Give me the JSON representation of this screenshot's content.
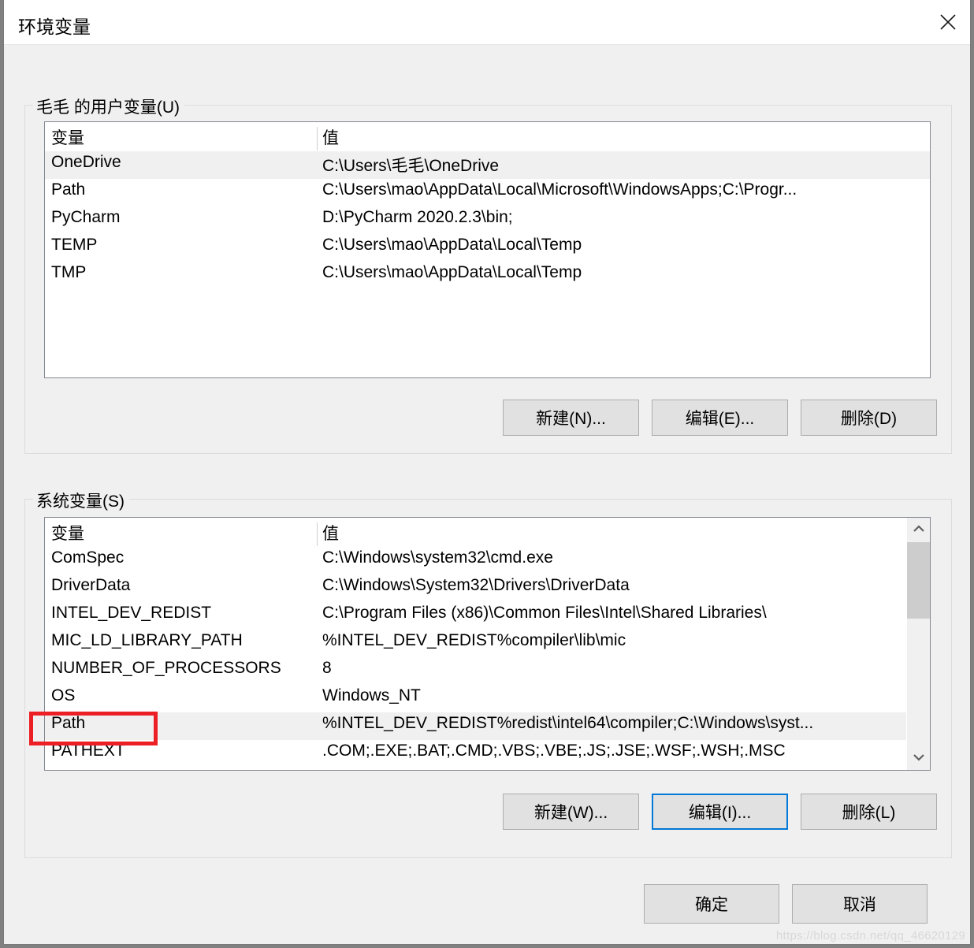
{
  "window": {
    "title": "环境变量",
    "close_icon": "close-icon"
  },
  "user_section": {
    "legend": "毛毛 的用户变量(U)",
    "columns": [
      "变量",
      "值"
    ],
    "rows": [
      {
        "name": "OneDrive",
        "value": "C:\\Users\\毛毛\\OneDrive",
        "selected": true
      },
      {
        "name": "Path",
        "value": "C:\\Users\\mao\\AppData\\Local\\Microsoft\\WindowsApps;C:\\Progr...",
        "selected": false
      },
      {
        "name": "PyCharm",
        "value": "D:\\PyCharm 2020.2.3\\bin;",
        "selected": false
      },
      {
        "name": "TEMP",
        "value": "C:\\Users\\mao\\AppData\\Local\\Temp",
        "selected": false
      },
      {
        "name": "TMP",
        "value": "C:\\Users\\mao\\AppData\\Local\\Temp",
        "selected": false
      }
    ],
    "buttons": {
      "new": "新建(N)...",
      "edit": "编辑(E)...",
      "delete": "删除(D)"
    }
  },
  "system_section": {
    "legend": "系统变量(S)",
    "columns": [
      "变量",
      "值"
    ],
    "rows": [
      {
        "name": "ComSpec",
        "value": "C:\\Windows\\system32\\cmd.exe",
        "selected": false
      },
      {
        "name": "DriverData",
        "value": "C:\\Windows\\System32\\Drivers\\DriverData",
        "selected": false
      },
      {
        "name": "INTEL_DEV_REDIST",
        "value": "C:\\Program Files (x86)\\Common Files\\Intel\\Shared Libraries\\",
        "selected": false
      },
      {
        "name": "MIC_LD_LIBRARY_PATH",
        "value": "%INTEL_DEV_REDIST%compiler\\lib\\mic",
        "selected": false
      },
      {
        "name": "NUMBER_OF_PROCESSORS",
        "value": "8",
        "selected": false
      },
      {
        "name": "OS",
        "value": "Windows_NT",
        "selected": false
      },
      {
        "name": "Path",
        "value": "%INTEL_DEV_REDIST%redist\\intel64\\compiler;C:\\Windows\\syst...",
        "selected": true
      },
      {
        "name": "PATHEXT",
        "value": ".COM;.EXE;.BAT;.CMD;.VBS;.VBE;.JS;.JSE;.WSF;.WSH;.MSC",
        "selected": false
      }
    ],
    "buttons": {
      "new": "新建(W)...",
      "edit": "编辑(I)...",
      "delete": "删除(L)"
    },
    "scrollbar": {
      "up_icon": "chevron-up-icon",
      "down_icon": "chevron-down-icon"
    }
  },
  "dialog_buttons": {
    "ok": "确定",
    "cancel": "取消"
  },
  "annotation": {
    "highlight_target": "Path",
    "color": "#ec2024"
  },
  "watermark": "https://blog.csdn.net/qq_46620129"
}
